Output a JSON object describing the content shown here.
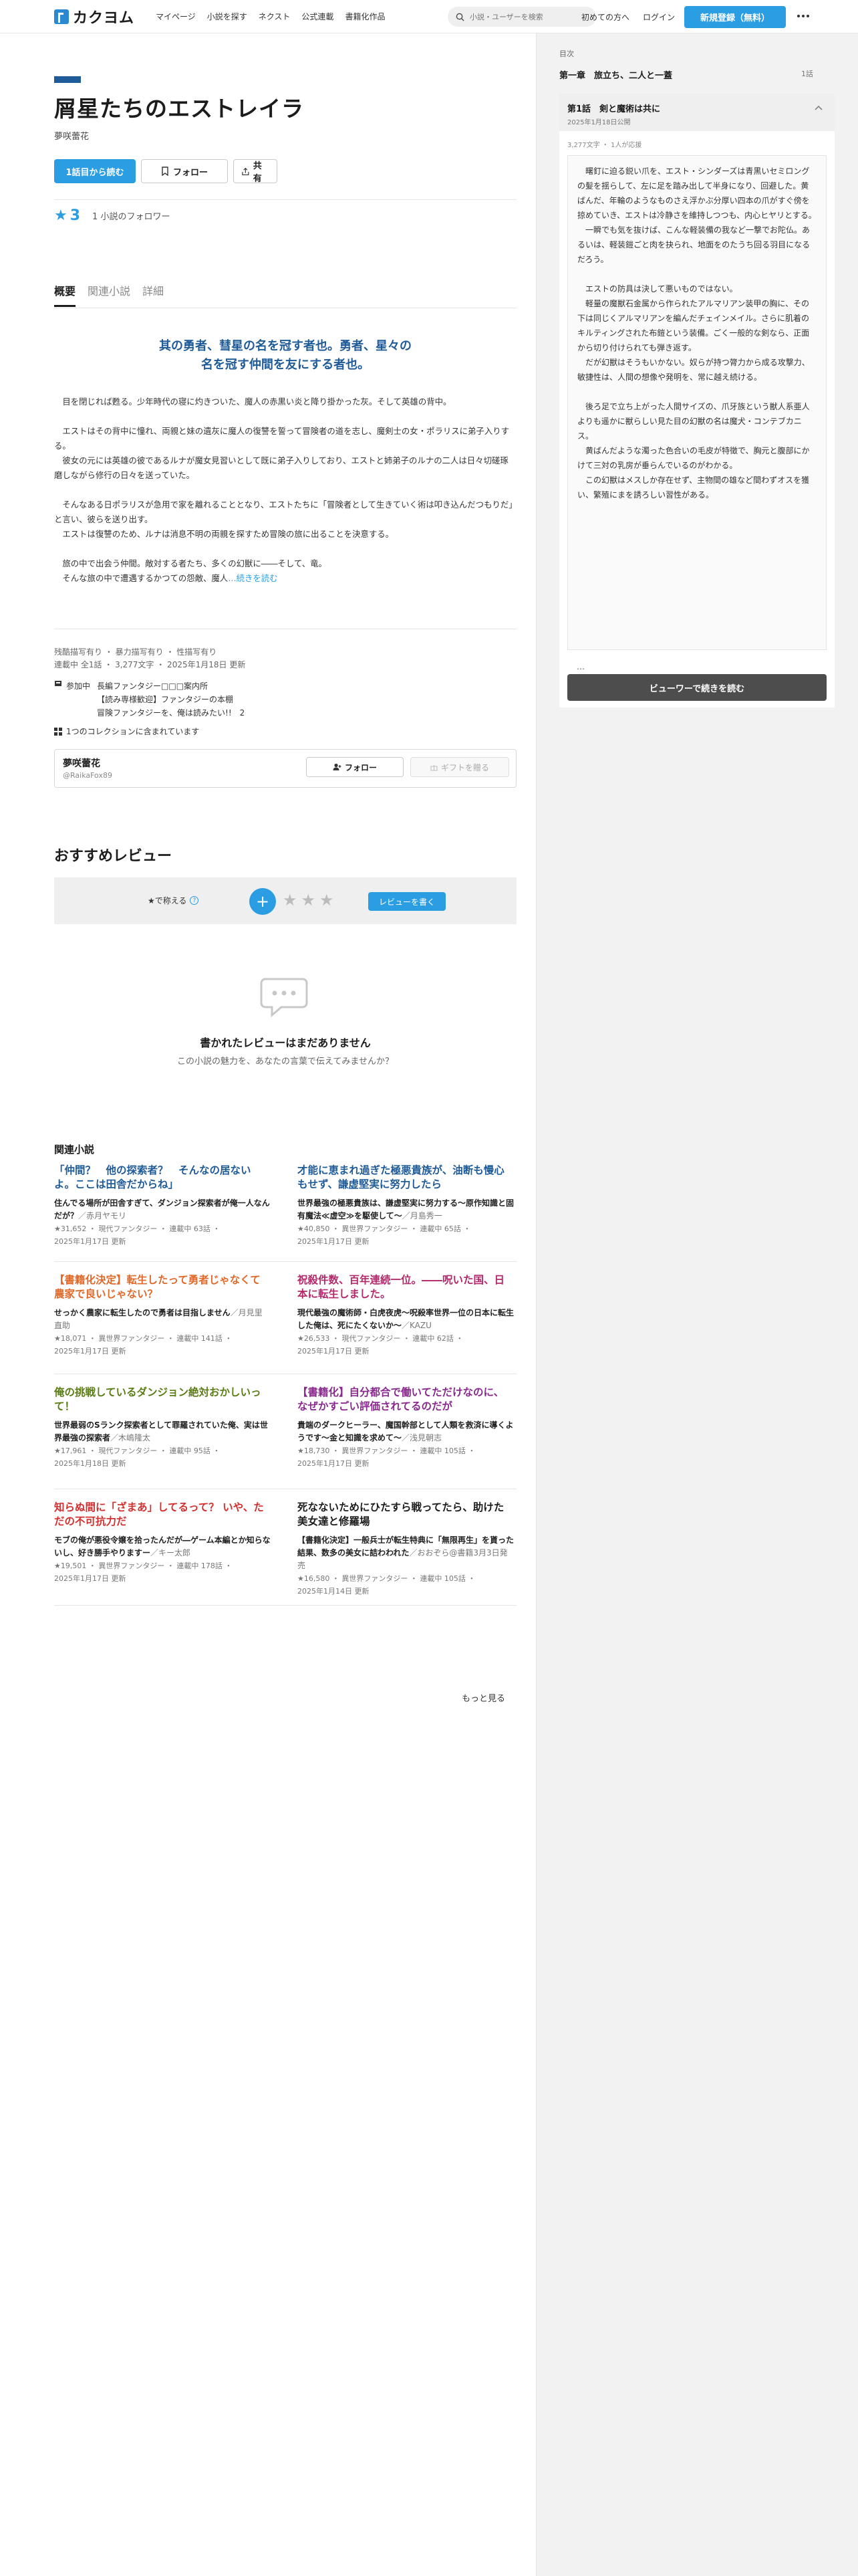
{
  "header": {
    "logo_text": "カクヨム",
    "nav": [
      "マイページ",
      "小説を探す",
      "ネクスト",
      "公式連載",
      "書籍化作品"
    ],
    "search_placeholder": "小説・ユーザーを検索",
    "first_time": "初めての方へ",
    "login": "ログイン",
    "signup": "新規登録（無料）"
  },
  "work": {
    "title": "屑星たちのエストレイラ",
    "author": "夢咲蕾花",
    "read_first": "1話目から読む",
    "follow": "フォロー",
    "share": "共有",
    "star_symbol": "★",
    "stars": "3",
    "followers": "1 小説のフォロワー",
    "tabs": [
      "概要",
      "関連小説",
      "詳細"
    ],
    "catchphrase_1": "其の勇者、彗星の名を冠す者也。勇者、星々の",
    "catchphrase_2": "名を冠す仲間を友にする者也。",
    "intro": [
      "　目を閉じれば甦る。少年時代の寝に灼きついた、魔人の赤黒い炎と降り掛かった灰。そして英雄の背中。",
      "　エストはその背中に憧れ、両親と妹の遺灰に魔人の復讐を誓って冒険者の道を志し、魔剣士の女・ポラリスに弟子入りする。\n　彼女の元には英雄の彼であるルナが魔女見習いとして既に弟子入りしており、エストと姉弟子のルナの二人は日々切磋琢磨しながら修行の日々を送っていた。",
      "　そんなある日ポラリスが急用で家を離れることとなり、エストたちに「冒険者として生きていく術は叩き込んだつもりだ」と言い、彼らを送り出す。\n　エストは復讐のため、ルナは消息不明の両親を探すため冒険の旅に出ることを決意する。",
      "　旅の中で出会う仲間。敵対する者たち、多くの幻獣に――そして、竜。\n　そんな旅の中で遭遇するかつての怨敵、魔人"
    ],
    "intro_more": "…続きを読む",
    "tags": "残酷描写有り ・ 暴力描写有り ・ 性描写有り",
    "meta": "連載中 全1話 ・ 3,277文字 ・ 2025年1月18日 更新",
    "contest_label": "参加中",
    "contest_lines": [
      "長編ファンタジー□□□案内所",
      "【読み専様歓迎】ファンタジーの本棚",
      "冒険ファンタジーを、俺は読みたい!!　2"
    ],
    "collections": "1つのコレクションに含まれています",
    "author_box": {
      "name": "夢咲蕾花",
      "id": "@RaikaFox89",
      "follow": "フォロー",
      "gift": "ギフトを贈る"
    }
  },
  "reviews": {
    "heading": "おすすめレビュー",
    "hint": "★で称える",
    "write": "レビューを書く",
    "empty_title": "書かれたレビューはまだありません",
    "empty_sub": "この小説の魅力を、あなたの言葉で伝えてみませんか？"
  },
  "related": {
    "heading": "関連小説",
    "more": "もっと見る",
    "items": [
      {
        "title": "「仲間？　他の探索者？　そんなの居ないよ。ここは田舎だからね」",
        "color": "#1f5b98",
        "desc": "住んでる場所が田舎すぎて、ダンジョン探索者が俺一人なんだが？",
        "author": "／赤月ヤモリ",
        "meta1": "★31,652 ・ 現代ファンタジー ・ 連載中 63話 ・",
        "meta2": "2025年1月17日 更新"
      },
      {
        "title": "才能に恵まれ過ぎた極悪貴族が、油断も慢心もせず、謙虚堅実に努力したら",
        "color": "#1f5b98",
        "desc": "世界最強の極悪貴族は、謙虚堅実に努力する～原作知識と固有魔法≪虚空≫を駆使して～",
        "author": "／月島秀一",
        "meta1": "★40,850 ・ 異世界ファンタジー ・ 連載中 65話 ・",
        "meta2": "2025年1月17日 更新"
      },
      {
        "title": "【書籍化決定】転生したって勇者じゃなくて農家で良いじゃない？",
        "color": "#e0692a",
        "desc": "せっかく農家に転生したので勇者は目指しません",
        "author": "／月見里　直助",
        "meta1": "★18,071 ・ 異世界ファンタジー ・ 連載中 141話 ・",
        "meta2": "2025年1月17日 更新"
      },
      {
        "title": "祝殺件数、百年連続一位。――呪いた国、日本に転生しました。",
        "color": "#b2286a",
        "desc": "現代最強の魔術師・白虎夜虎～呪殺率世界一位の日本に転生した俺は、死にたくないか～",
        "author": "／KAZU",
        "meta1": "★26,533 ・ 現代ファンタジー ・ 連載中 62話 ・",
        "meta2": "2025年1月17日 更新"
      },
      {
        "title": "俺の挑戦しているダンジョン絶対おかしいって！",
        "color": "#5a7d16",
        "desc": "世界最弱のSランク探索者として罪羅されていた俺、実は世界最強の探索者",
        "author": "／木嶋隆太",
        "meta1": "★17,961 ・ 現代ファンタジー ・ 連載中 95話 ・",
        "meta2": "2025年1月18日 更新"
      },
      {
        "title": "【書籍化】自分都合で働いてただけなのに、なぜかすごい評価されてるのだが",
        "color": "#8a2a8f",
        "desc": "貴端のダークヒーラー、魔国幹部として人類を救済に導くようです～金と知識を求めて～",
        "author": "／浅見朝志",
        "meta1": "★18,730 ・ 異世界ファンタジー ・ 連載中 105話 ・",
        "meta2": "2025年1月17日 更新"
      },
      {
        "title": "知らぬ間に「ざまあ」してるって？ いや、ただの不可抗力だ",
        "color": "#d32f2f",
        "desc": "モブの俺が悪役令嬢を拾ったんだが―ゲーム本編とか知らないし、好き勝手やりますー",
        "author": "／キー太郎",
        "meta1": "★19,501 ・ 異世界ファンタジー ・ 連載中 178話 ・",
        "meta2": "2025年1月17日 更新"
      },
      {
        "title": "死なないためにひたすら戦ってたら、助けた美女達と修羅場",
        "color": "#1c1c1c",
        "desc": "【書籍化決定】一般兵士が転生特典に「無限再生」を貰った結果、数多の美女に詰わわれた",
        "author": "／おおぞら@書籍3月3日発売",
        "meta1": "★16,580 ・ 異世界ファンタジー ・ 連載中 105話 ・",
        "meta2": "2025年1月14日 更新"
      }
    ]
  },
  "sidebar": {
    "toc_label": "目次",
    "chapter": "第一章　旅立ち、二人と一蓋",
    "chapter_count": "1話",
    "episode_title": "第1話　剣と魔術は共に",
    "episode_date": "2025年1月18日公開",
    "episode_meta": "3,277文字 ・ 1人が応援",
    "preview": [
      "　曙釘に迫る鋭い爪を、エスト・シンダーズは青黒いセミロングの髪を揺らして、左に足を踏み出して半身になり、回避した。黄ばんだ、年輪のようなものさえ浮かぶ分厚い四本の爪がすぐ傍を掠めていき、エストは冷静さを維持しつつも、内心ヒヤリとする。\n　一瞬でも気を抜けば、こんな軽装備の我など一撃でお陀仏。あるいは、軽装鎧ごと肉を抉られ、地面をのたうち回る羽目になるだろう。",
      "　エストの防具は決して悪いものではない。\n　軽量の魔獣石金属から作られたアルマリアン装甲の胸に、その下は同じくアルマリアンを編んだチェインメイル。さらに肌着のキルティングされた布鎧という装備。ごく一般的な剣なら、正面から切り付けられても弾き返す。\n　だが幻獣はそうもいかない。奴らが持つ膂力から成る攻撃力、敏捷性は、人間の想像や発明を、常に越え続ける。",
      "　後ろ足で立ち上がった人間サイズの、爪牙族という獣人系亜人よりも遥かに獣らしい見た目の幻獣の名は魔犬・コンテブカニス。\n　黄ばんだような濁った色合いの毛皮が特徴で、胸元と腹部にかけて三対の乳房が垂らんでいるのがわかる。\n　この幻獣はメスしか存在せず、主物間の雄など間わずオスを獲い、繁殖にまを誘ろしい習性がある。"
    ],
    "ellipsis": "…",
    "viewer_button": "ビューワーで続きを読む"
  }
}
